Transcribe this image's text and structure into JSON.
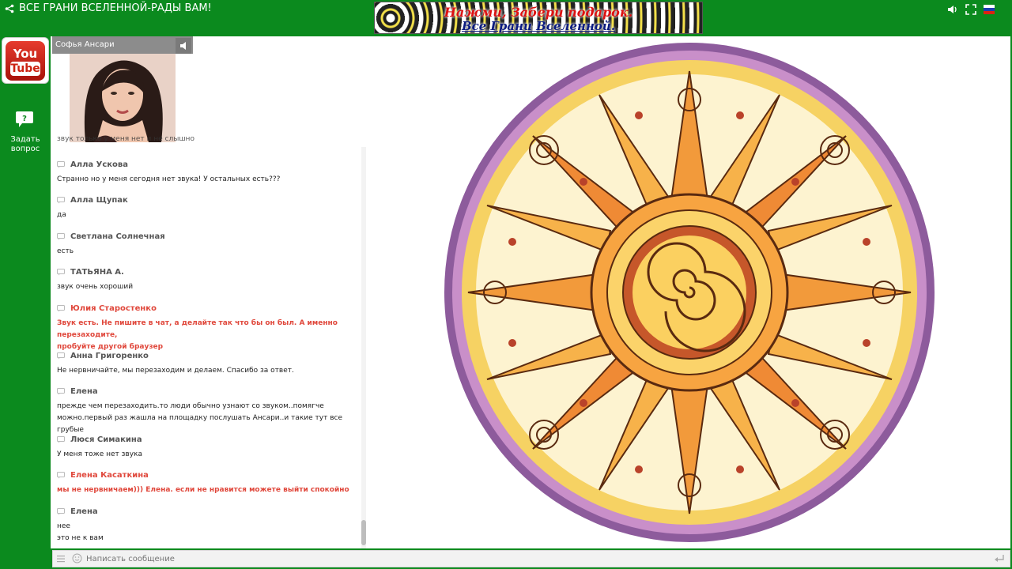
{
  "header": {
    "title": "ВСЕ ГРАНИ ВСЕЛЕННОЙ-РАДЫ ВАМ!",
    "banner_line1": "Нажми, Забери подарок.",
    "banner_line2": "Все Грани Вселенной."
  },
  "colors": {
    "brand_green": "#0b8a1e",
    "mod_red": "#e0483c"
  },
  "sidebar": {
    "youtube_you": "You",
    "youtube_tube": "Tube",
    "ask_label_1": "Задать",
    "ask_label_2": "вопрос"
  },
  "video": {
    "speaker_name": "Софья Ансари"
  },
  "chat": {
    "cut_text": "звук только у меня нет и не слышно",
    "messages": [
      {
        "author": "Алла Ускова",
        "lines": [
          "Странно но у меня сегодня нет звука! У остальных есть???"
        ]
      },
      {
        "author": "Алла Щупак",
        "lines": [
          "да"
        ]
      },
      {
        "author": "Светлана Солнечная",
        "lines": [
          "есть"
        ]
      },
      {
        "author": "ТАТЬЯНА А.",
        "lines": [
          "звук очень хороший"
        ]
      },
      {
        "author": "Юлия Старостенко",
        "lines": [
          "Звук есть. Не пишите в чат, а делайте так что бы он был. А именно перезаходите,",
          "пробуйте другой браузер"
        ]
      },
      {
        "author": "Анна Григоренко",
        "lines": [
          "Не нервничайте, мы перезаходим и делаем. Спасибо за ответ."
        ]
      },
      {
        "author": "Елена",
        "lines": [
          "прежде чем перезаходить.то люди обычно узнают со звуком..помягче",
          "можно.первый раз жашла на площадку послушать Ансари..и такие тут все грубые"
        ]
      },
      {
        "author": "Люся Симакина",
        "lines": [
          "У меня тоже нет звука"
        ]
      },
      {
        "author": "Елена Касаткина",
        "lines": [
          "мы не нервничаем))) Елена. если не нравится можете выйти спокойно"
        ]
      },
      {
        "author": "Елена",
        "lines": [
          "нее",
          "это не к вам"
        ]
      }
    ]
  },
  "composer": {
    "placeholder": "Написать сообщение"
  },
  "icons": [
    "share-icon",
    "volume-icon",
    "fullscreen-icon",
    "russian-flag-icon",
    "youtube-logo",
    "question-chat-icon",
    "chat-user-icon",
    "menu-icon",
    "smile-icon",
    "send-icon",
    "mute-icon"
  ]
}
